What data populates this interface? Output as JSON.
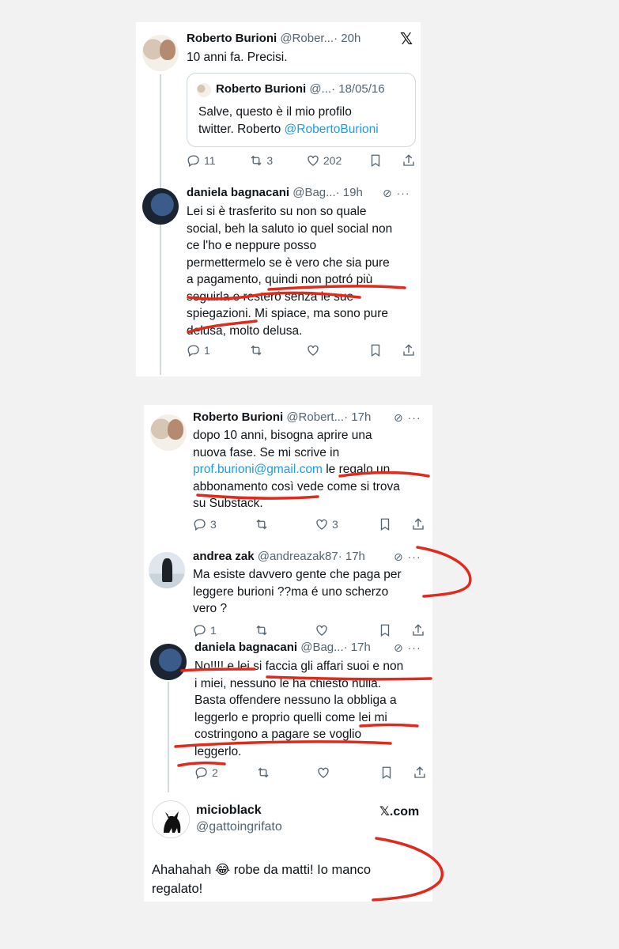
{
  "s1": {
    "tweet1": {
      "name": "Roberto Burioni",
      "handle": "@Rober...",
      "time": "· 20h",
      "x_logo": "𝕏",
      "text": "10 anni fa. Precisi.",
      "quote": {
        "name": "Roberto Burioni",
        "handle": "@...",
        "date": "· 18/05/16",
        "text_line1": "Salve, questo è il mio profilo",
        "text_line2": "twitter. Roberto ",
        "mention": "@RobertoBurioni"
      },
      "replies": "11",
      "retweets": "3",
      "likes": "202"
    },
    "tweet2": {
      "name": "daniela bagnacani",
      "handle": "@Bag...",
      "time": "· 19h",
      "lines": [
        "Lei si è trasferito su non so quale",
        "social, beh la saluto io quel social non",
        "ce l'ho e neppure posso",
        "permettermelo se è vero che sia pure",
        "a pagamento, quindi non potró più",
        "seguirla e resteró senza le sue",
        "spiegazioni. Mi spiace, ma sono pure",
        "delusa, molto delusa."
      ],
      "replies": "1"
    }
  },
  "s2": {
    "tweet3": {
      "name": "Roberto Burioni",
      "handle": "@Robert...",
      "time": "· 17h",
      "line1": "dopo 10 anni, bisogna aprire una",
      "line2": "nuova fase. Se mi scrive in",
      "email": "prof.burioni@gmail.com",
      "line3_rest": " le regalo un",
      "line4": "abbonamento così vede come si trova",
      "line5": "su Substack.",
      "replies": "3",
      "likes": "3"
    },
    "tweet4": {
      "name": "andrea zak",
      "handle": "@andreazak87",
      "time": "· 17h",
      "lines": [
        "Ma esiste davvero gente che paga per",
        "leggere burioni ??ma é uno scherzo",
        "vero ?"
      ],
      "replies": "1"
    },
    "tweet5": {
      "name": "daniela bagnacani",
      "handle": "@Bag...",
      "time": "· 17h",
      "lines": [
        "No!!!! e lei si faccia gli affari suoi e non",
        "i miei, nessuno le ha chiesto nulla.",
        "Basta offendere nessuno la obbliga a",
        "leggerlo e proprio quelli come lei mi",
        "costringono a pagare se voglio",
        "leggerlo."
      ],
      "replies": "2"
    }
  },
  "s3": {
    "name": "micioblack",
    "handle": "@gattoingrifato",
    "brand": "𝕏.com",
    "line1": "Ahahahah 😂 robe da matti! Io manco",
    "line2": "regalato!"
  },
  "colors": {
    "ink": "#e02a1b",
    "link": "#1d9bf0",
    "muted": "#536471"
  }
}
